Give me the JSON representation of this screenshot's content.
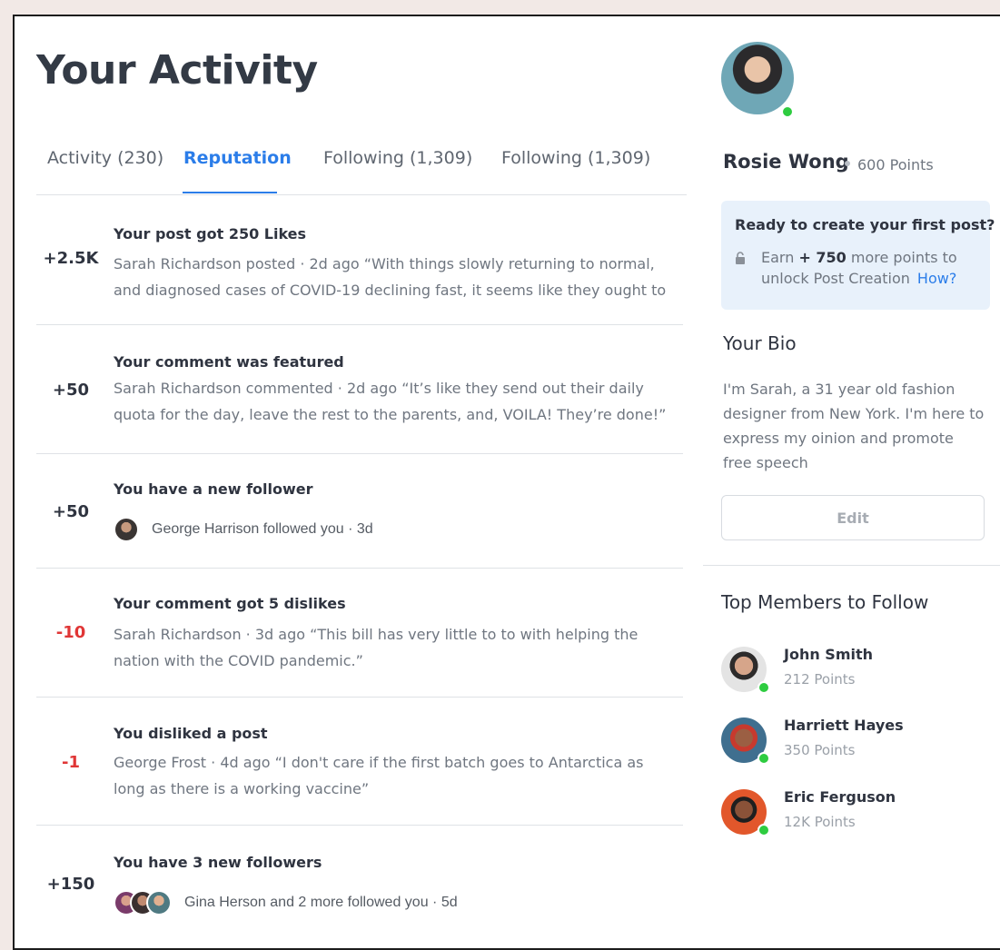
{
  "page": {
    "title": "Your Activity"
  },
  "tabs": [
    {
      "label": "Activity (230)",
      "active": false
    },
    {
      "label": "Reputation",
      "active": true
    },
    {
      "label": "Following (1,309)",
      "active": false
    },
    {
      "label": "Following (1,309)",
      "active": false
    }
  ],
  "feed": [
    {
      "points": "+2.5K",
      "title": "Your post got 250 Likes",
      "text": "Sarah Richardson posted · 2d ago “With things slowly returning to normal, and diagnosed cases of COVID-19 declining fast, it seems like they ought to"
    },
    {
      "points": "+50",
      "title": "Your comment was featured",
      "text": "Sarah Richardson commented · 2d ago “It’s like they send out their daily quota for the day, leave the rest to the parents, and, VOILA! They’re done!”"
    },
    {
      "points": "+50",
      "title": "You have a new follower",
      "follow_text": "George Harrison followed you · 3d"
    },
    {
      "points": "-10",
      "title": "Your comment got 5 dislikes",
      "text": "Sarah Richardson · 3d ago “This bill has very little to to with helping the nation with the COVID pandemic.”"
    },
    {
      "points": "-1",
      "title": "You disliked a post",
      "text": "George Frost · 4d ago “I don't care if the first batch goes to Antarctica as long as there is a working vaccine”"
    },
    {
      "points": "+150",
      "title": "You have 3 new followers",
      "follow_text": "Gina Herson and 2 more followed you · 5d"
    }
  ],
  "profile": {
    "name": "Rosie Wong",
    "points": "600 Points"
  },
  "callout": {
    "title": "Ready to create your first post?",
    "text_before": "Earn ",
    "text_bold": "+ 750",
    "text_after": " more points to unlock Post Creation",
    "link": "How?"
  },
  "bio": {
    "heading": "Your Bio",
    "text": "I'm Sarah, a 31 year old fashion designer from New York. I'm here to express my oinion and promote free speech",
    "edit_label": "Edit"
  },
  "members": {
    "heading": "Top Members to Follow",
    "items": [
      {
        "name": "John Smith",
        "points": "212 Points"
      },
      {
        "name": "Harriett Hayes",
        "points": "350 Points"
      },
      {
        "name": "Eric Ferguson",
        "points": "12K Points"
      }
    ]
  },
  "colors": {
    "accent": "#2b7de9",
    "negative": "#e03636",
    "online": "#2ecc40",
    "callout_bg": "#e8f1fb"
  }
}
